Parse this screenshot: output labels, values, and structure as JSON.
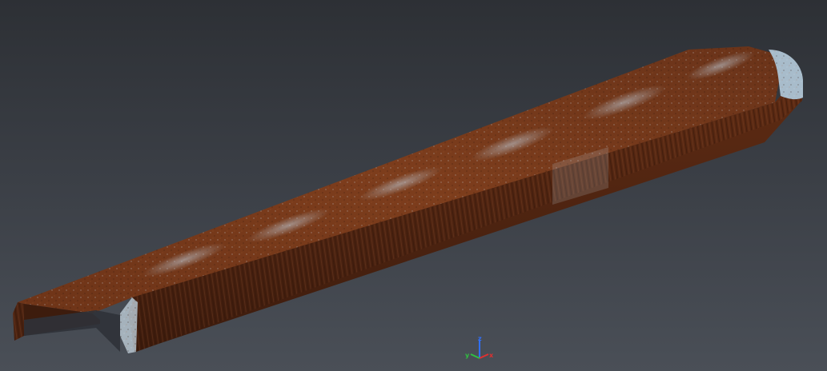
{
  "viewport": {
    "background_top": "#2d3035",
    "background_bottom": "#4a4f57"
  },
  "model": {
    "icon": "point-cloud-channel-beam",
    "colors": {
      "rust_dark": "#4a2411",
      "rust": "#7a3a1a",
      "rust_light": "#a55a2e",
      "highlight": "#b8c8d6"
    }
  },
  "axis_gizmo": {
    "x_label": "x",
    "y_label": "y",
    "z_label": "z",
    "x_color": "#e03030",
    "y_color": "#30c040",
    "z_color": "#3070ff"
  }
}
